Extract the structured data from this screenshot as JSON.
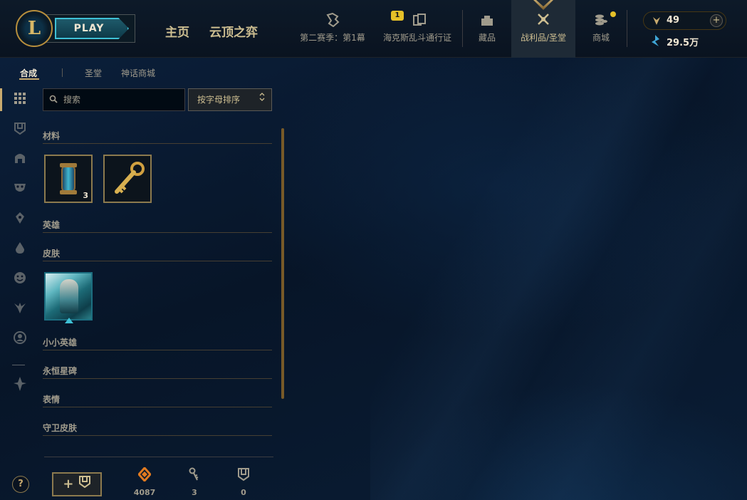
{
  "header": {
    "play_label": "PLAY",
    "nav_main": [
      "主页",
      "云顶之弈"
    ],
    "nav_items": [
      {
        "label": "第二赛季：第1幕",
        "icon": "season-icon"
      },
      {
        "label": "海克斯乱斗通行证",
        "icon": "pass-icon",
        "badge": "1"
      },
      {
        "label": "藏品",
        "icon": "collection-icon"
      },
      {
        "label": "战利品/圣堂",
        "icon": "loot-icon",
        "active": true
      },
      {
        "label": "商城",
        "icon": "store-icon"
      }
    ],
    "currency": {
      "rp": "49",
      "blue_essence": "29.5万"
    }
  },
  "subtabs": [
    "合成",
    "圣堂",
    "神话商城"
  ],
  "search": {
    "placeholder": "搜索"
  },
  "sort": {
    "label": "按字母排序"
  },
  "categories": {
    "materials": "材料",
    "champions": "英雄",
    "skins": "皮肤",
    "little_legends": "小小英雄",
    "eternals": "永恒星碑",
    "emotes": "表情",
    "ward_skins": "守卫皮肤"
  },
  "materials_items": [
    {
      "name": "hextech-capsule",
      "count": "3"
    },
    {
      "name": "hextech-key",
      "count": ""
    }
  ],
  "bottom": {
    "add_label": "+",
    "stats": [
      {
        "icon": "orange-essence-icon",
        "value": "4087",
        "color": "#e07a20"
      },
      {
        "icon": "key-fragment-icon",
        "value": "3",
        "color": "#a09b8c"
      },
      {
        "icon": "chest-icon",
        "value": "0",
        "color": "#a09b8c"
      }
    ]
  },
  "help_label": "?"
}
